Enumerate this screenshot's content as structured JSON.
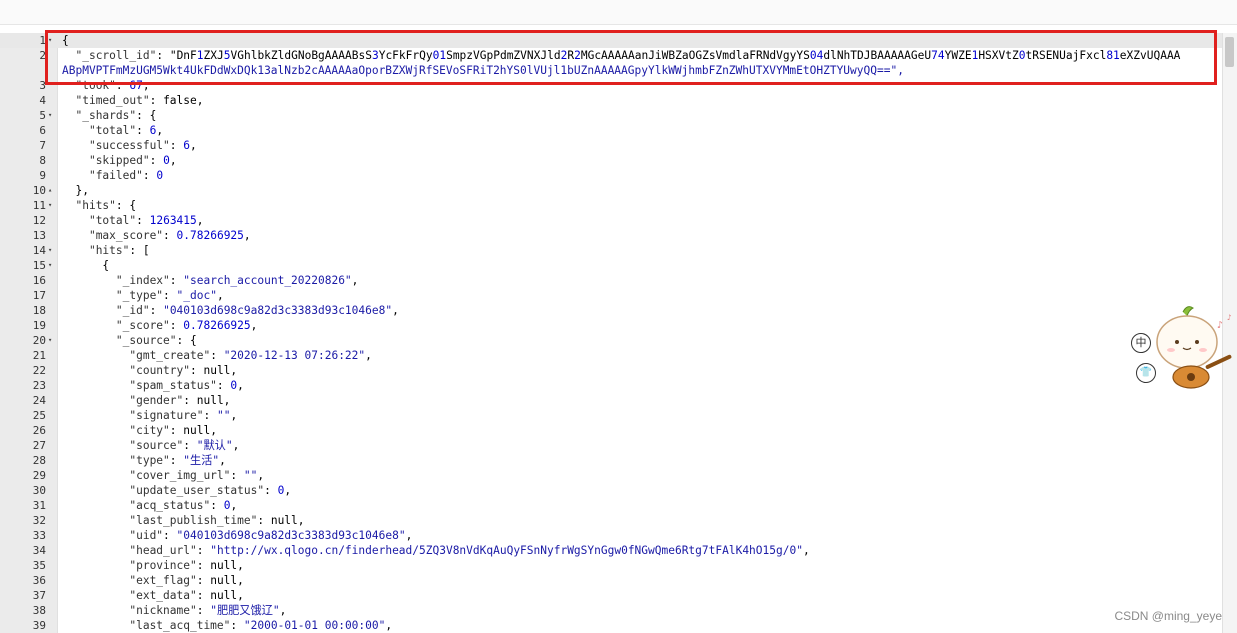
{
  "editor": {
    "lines": [
      {
        "n": "1",
        "fold": "▾",
        "t": "{",
        "active": true
      },
      {
        "n": "2",
        "fold": "",
        "t": "  \"_scroll_id\": \"DnF1ZXJ5VGhlbkZldGNoBgAAAABsS3YcFkFrQy01SmpzVGpPdmZVNXJld2R2MGcAAAAAanJiWBZaOGZsVmdlaFRNdVgyYS04dlNhTDJBAAAAAGeU74YWZE1HSXVtZ0tRSENUajFxcl81eXZvUQAAA",
        "wrap": "ABpMVPTFmMzUGM5Wkt4UkFDdWxDQk13alNzb2cAAAAAaOporBZXWjRfSEVoSFRiT2hYS0lVUjl1bUZnAAAAAGpyYlkWWjhmbFZnZWhUTXVYMmEtOHZTYUwyQQ==\","
      },
      {
        "n": "3",
        "fold": "",
        "t": "  \"took\": 67,"
      },
      {
        "n": "4",
        "fold": "",
        "t": "  \"timed_out\": false,"
      },
      {
        "n": "5",
        "fold": "▾",
        "t": "  \"_shards\": {"
      },
      {
        "n": "6",
        "fold": "",
        "t": "    \"total\": 6,"
      },
      {
        "n": "7",
        "fold": "",
        "t": "    \"successful\": 6,"
      },
      {
        "n": "8",
        "fold": "",
        "t": "    \"skipped\": 0,"
      },
      {
        "n": "9",
        "fold": "",
        "t": "    \"failed\": 0"
      },
      {
        "n": "10",
        "fold": "▴",
        "t": "  },"
      },
      {
        "n": "11",
        "fold": "▾",
        "t": "  \"hits\": {"
      },
      {
        "n": "12",
        "fold": "",
        "t": "    \"total\": 1263415,"
      },
      {
        "n": "13",
        "fold": "",
        "t": "    \"max_score\": 0.78266925,"
      },
      {
        "n": "14",
        "fold": "▾",
        "t": "    \"hits\": ["
      },
      {
        "n": "15",
        "fold": "▾",
        "t": "      {"
      },
      {
        "n": "16",
        "fold": "",
        "t": "        \"_index\": \"search_account_20220826\","
      },
      {
        "n": "17",
        "fold": "",
        "t": "        \"_type\": \"_doc\","
      },
      {
        "n": "18",
        "fold": "",
        "t": "        \"_id\": \"040103d698c9a82d3c3383d93c1046e8\","
      },
      {
        "n": "19",
        "fold": "",
        "t": "        \"_score\": 0.78266925,"
      },
      {
        "n": "20",
        "fold": "▾",
        "t": "        \"_source\": {"
      },
      {
        "n": "21",
        "fold": "",
        "t": "          \"gmt_create\": \"2020-12-13 07:26:22\","
      },
      {
        "n": "22",
        "fold": "",
        "t": "          \"country\": null,"
      },
      {
        "n": "23",
        "fold": "",
        "t": "          \"spam_status\": 0,"
      },
      {
        "n": "24",
        "fold": "",
        "t": "          \"gender\": null,"
      },
      {
        "n": "25",
        "fold": "",
        "t": "          \"signature\": \"\","
      },
      {
        "n": "26",
        "fold": "",
        "t": "          \"city\": null,"
      },
      {
        "n": "27",
        "fold": "",
        "t": "          \"source\": \"默认\","
      },
      {
        "n": "28",
        "fold": "",
        "t": "          \"type\": \"生活\","
      },
      {
        "n": "29",
        "fold": "",
        "t": "          \"cover_img_url\": \"\","
      },
      {
        "n": "30",
        "fold": "",
        "t": "          \"update_user_status\": 0,"
      },
      {
        "n": "31",
        "fold": "",
        "t": "          \"acq_status\": 0,"
      },
      {
        "n": "32",
        "fold": "",
        "t": "          \"last_publish_time\": null,"
      },
      {
        "n": "33",
        "fold": "",
        "t": "          \"uid\": \"040103d698c9a82d3c3383d93c1046e8\","
      },
      {
        "n": "34",
        "fold": "",
        "t": "          \"head_url\": \"http://wx.qlogo.cn/finderhead/5ZQ3V8nVdKqAuQyFSnNyfrWgSYnGgw0fNGwQme6Rtg7tFAlK4hO15g/0\","
      },
      {
        "n": "35",
        "fold": "",
        "t": "          \"province\": null,"
      },
      {
        "n": "36",
        "fold": "",
        "t": "          \"ext_flag\": null,"
      },
      {
        "n": "37",
        "fold": "",
        "t": "          \"ext_data\": null,"
      },
      {
        "n": "38",
        "fold": "",
        "t": "          \"nickname\": \"肥肥又饿辽\","
      },
      {
        "n": "39",
        "fold": "",
        "t": "          \"last_acq_time\": \"2000-01-01 00:00:00\","
      }
    ]
  },
  "float_buttons": {
    "lang": "中",
    "skin": "👕"
  },
  "watermark": "CSDN @ming_yeye",
  "colors": {
    "highlight": "#e0201e",
    "string": "#1a1aa6"
  }
}
